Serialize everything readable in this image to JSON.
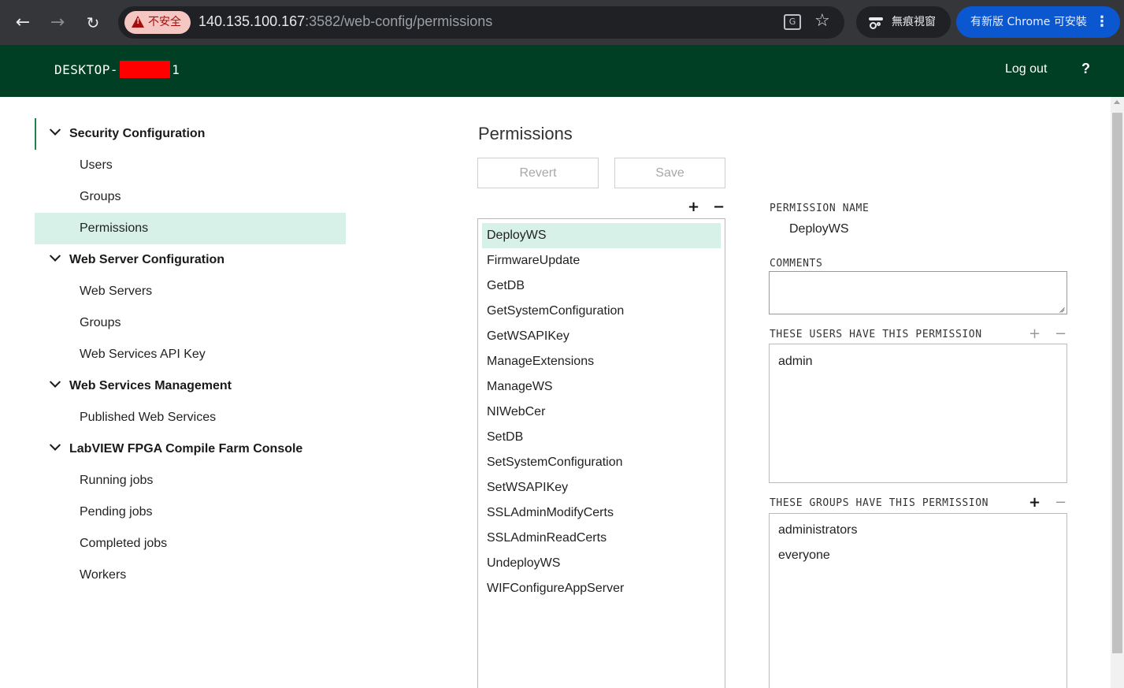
{
  "browser": {
    "security_label": "不安全",
    "url_host": "140.135.100.167",
    "url_rest": ":3582/web-config/permissions",
    "incognito_label": "無痕視窗",
    "update_label": "有新版 Chrome 可安裝",
    "icons": [
      "back-arrow-icon",
      "forward-arrow-icon",
      "reload-icon",
      "warning-icon",
      "translate-icon",
      "star-icon",
      "incognito-icon",
      "kebab-menu-icon"
    ]
  },
  "header": {
    "host_prefix": "DESKTOP-",
    "host_suffix": "1",
    "logout_label": "Log out",
    "help_label": "?"
  },
  "colors": {
    "header_bg": "#003f24",
    "selection_bg": "#d8f1e8",
    "accent": "#1e8449"
  },
  "sidebar": {
    "sections": [
      {
        "title": "Security Configuration",
        "items": [
          "Users",
          "Groups",
          "Permissions"
        ]
      },
      {
        "title": "Web Server Configuration",
        "items": [
          "Web Servers",
          "Groups",
          "Web Services API Key"
        ]
      },
      {
        "title": "Web Services Management",
        "items": [
          "Published Web Services"
        ]
      },
      {
        "title": "LabVIEW FPGA Compile Farm Console",
        "items": [
          "Running jobs",
          "Pending jobs",
          "Completed jobs",
          "Workers"
        ]
      }
    ],
    "active_item": "Permissions"
  },
  "main": {
    "title": "Permissions",
    "revert_label": "Revert",
    "save_label": "Save",
    "add_symbol": "+",
    "remove_symbol": "−",
    "permissions": [
      "DeployWS",
      "FirmwareUpdate",
      "GetDB",
      "GetSystemConfiguration",
      "GetWSAPIKey",
      "ManageExtensions",
      "ManageWS",
      "NIWebCer",
      "SetDB",
      "SetSystemConfiguration",
      "SetWSAPIKey",
      "SSLAdminModifyCerts",
      "SSLAdminReadCerts",
      "UndeployWS",
      "WIFConfigureAppServer"
    ],
    "selected_permission": "DeployWS"
  },
  "details": {
    "name_label": "PERMISSION NAME",
    "name_value": "DeployWS",
    "comments_label": "COMMENTS",
    "comments_value": "",
    "users_label": "THESE USERS HAVE THIS PERMISSION",
    "users": [
      "admin"
    ],
    "groups_label": "THESE GROUPS HAVE THIS PERMISSION",
    "groups": [
      "administrators",
      "everyone"
    ]
  }
}
